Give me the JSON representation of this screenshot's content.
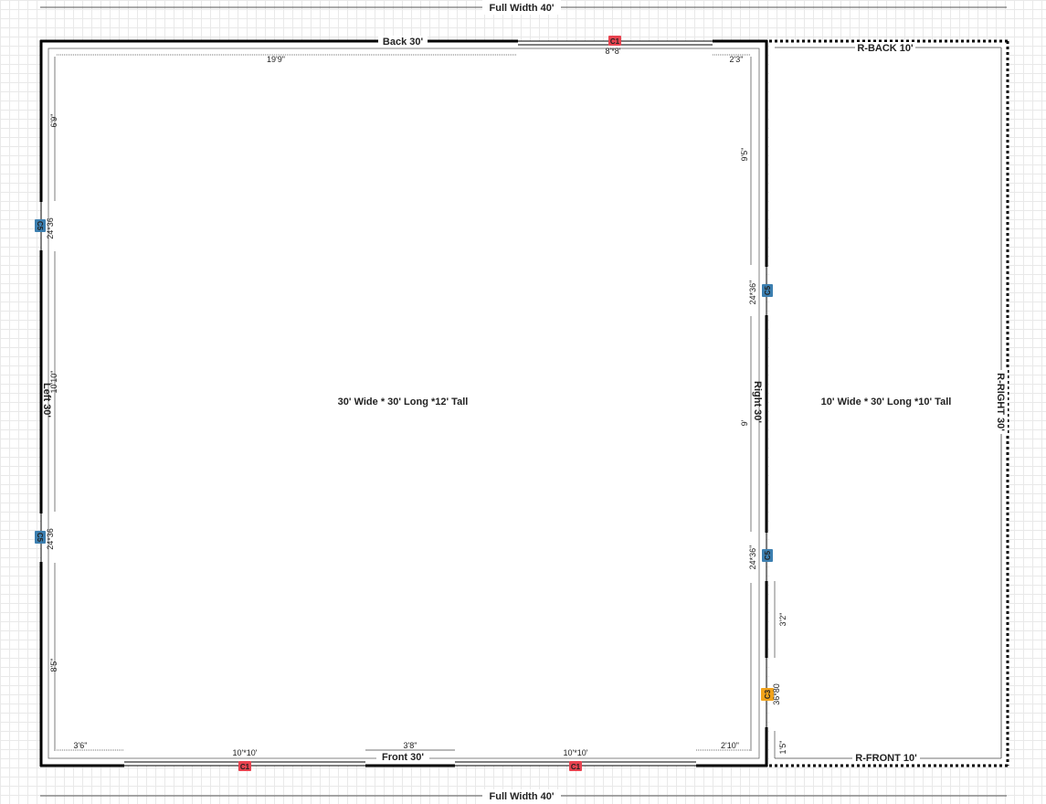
{
  "building": {
    "full_width_label": "Full Width 40'",
    "main": {
      "title": "30' Wide * 30' Long *12' Tall",
      "walls": {
        "back": "Back 30'",
        "front": "Front 30'",
        "left": "Left 30'",
        "right": "Right 30'"
      }
    },
    "leanto": {
      "title": "10' Wide * 30' Long *10' Tall",
      "walls": {
        "back": "R-BACK 10'",
        "front": "R-FRONT 10'",
        "right": "R-RIGHT 30'"
      }
    }
  },
  "openings": {
    "back_door": {
      "tag": "C1",
      "size": "8'*8'",
      "color": "#e8434f"
    },
    "front_door_left": {
      "tag": "C1",
      "size": "10'*10'",
      "color": "#e8434f"
    },
    "front_door_right": {
      "tag": "C1",
      "size": "10'*10'",
      "color": "#e8434f"
    },
    "left_window_upper": {
      "tag": "C5",
      "size": "24*36",
      "color": "#3c7fb0"
    },
    "left_window_lower": {
      "tag": "C5",
      "size": "24*36",
      "color": "#3c7fb0"
    },
    "right_window_upper": {
      "tag": "C5",
      "size": "24*36\"",
      "color": "#3c7fb0"
    },
    "right_window_lower": {
      "tag": "C5",
      "size": "24*36\"",
      "color": "#3c7fb0"
    },
    "walk_door": {
      "tag": "C3",
      "size": "36*80",
      "color": "#f2a31b"
    }
  },
  "dimensions": {
    "back_left": "19'9\"",
    "back_right": "2'3\"",
    "front_left": "3'6\"",
    "front_mid": "3'8\"",
    "front_right": "2'10\"",
    "left_top": "6'9\"",
    "left_mid": "10'10\"",
    "left_bottom": "8'5\"",
    "right_top": "9'5\"",
    "right_mid": "9'",
    "right_low": "3'2\"",
    "right_bottom": "1'5\""
  }
}
